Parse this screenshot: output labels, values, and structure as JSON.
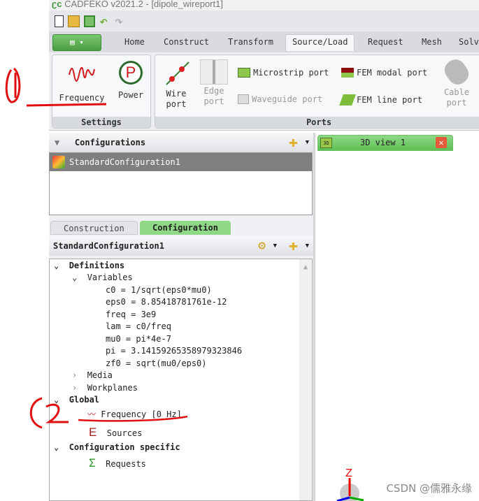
{
  "window": {
    "title": "CADFEKO v2021.2 - [dipole_wireport1]"
  },
  "quick_access": {
    "icons": [
      "new-file-icon",
      "open-file-icon",
      "save-icon",
      "undo-icon",
      "redo-icon"
    ]
  },
  "tabs": [
    {
      "label": "Home"
    },
    {
      "label": "Construct"
    },
    {
      "label": "Transform"
    },
    {
      "label": "Source/Load",
      "active": true
    },
    {
      "label": "Request"
    },
    {
      "label": "Mesh"
    },
    {
      "label": "Solv"
    }
  ],
  "ribbon": {
    "settings": {
      "label": "Settings",
      "frequency": "Frequency",
      "power": "Power"
    },
    "ports": {
      "label": "Ports",
      "wire_port": [
        "Wire",
        "port"
      ],
      "edge_port": [
        "Edge",
        "port"
      ],
      "microstrip": "Microstrip port",
      "waveguide": "Waveguide port",
      "fem_modal": "FEM modal port",
      "fem_line": "FEM line port",
      "cable_port": [
        "Cable",
        "port"
      ]
    }
  },
  "configurations": {
    "title": "Configurations",
    "items": [
      "StandardConfiguration1"
    ]
  },
  "panel_tabs": {
    "construction": "Construction",
    "configuration": "Configuration"
  },
  "config_header": "StandardConfiguration1",
  "tree": {
    "definitions": "Definitions",
    "variables": "Variables",
    "vars": [
      "c0 = 1/sqrt(eps0*mu0)",
      "eps0 = 8.85418781761e-12",
      "freq = 3e9",
      "lam = c0/freq",
      "mu0 = pi*4e-7",
      "pi = 3.14159265358979323846",
      "zf0 = sqrt(mu0/eps0)"
    ],
    "media": "Media",
    "workplanes": "Workplanes",
    "global": "Global",
    "frequency": "Frequency [0 Hz]",
    "sources": "Sources",
    "config_specific": "Configuration specific",
    "requests": "Requests"
  },
  "view": {
    "tab": "3D view 1",
    "axis_z": "Z"
  },
  "watermark": "CSDN @儒雅永缘",
  "colors": {
    "accent_green": "#5fbf55",
    "annotation_red": "#e01010",
    "selected_row": "#7f7f7f"
  }
}
